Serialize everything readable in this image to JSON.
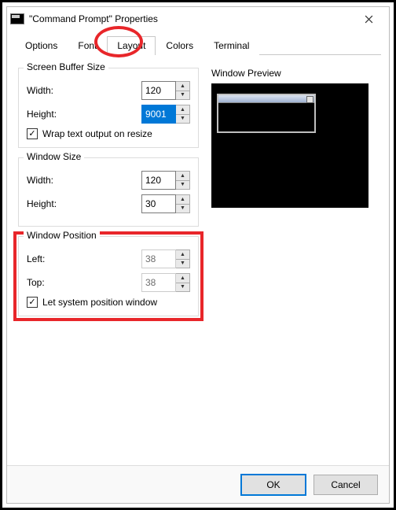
{
  "window_title": "\"Command Prompt\" Properties",
  "tabs": {
    "options": "Options",
    "font": "Font",
    "layout": "Layout",
    "colors": "Colors",
    "terminal": "Terminal"
  },
  "active_tab": "layout",
  "screen_buffer": {
    "title": "Screen Buffer Size",
    "width_label": "Width:",
    "width_value": "120",
    "height_label": "Height:",
    "height_value": "9001",
    "wrap_label": "Wrap text output on resize",
    "wrap_checked": true
  },
  "window_size": {
    "title": "Window Size",
    "width_label": "Width:",
    "width_value": "120",
    "height_label": "Height:",
    "height_value": "30"
  },
  "window_position": {
    "title": "Window Position",
    "left_label": "Left:",
    "left_value": "38",
    "top_label": "Top:",
    "top_value": "38",
    "auto_label": "Let system position window",
    "auto_checked": true
  },
  "preview_title": "Window Preview",
  "buttons": {
    "ok": "OK",
    "cancel": "Cancel"
  },
  "glyphs": {
    "check": "✓",
    "up": "▲",
    "down": "▼"
  }
}
